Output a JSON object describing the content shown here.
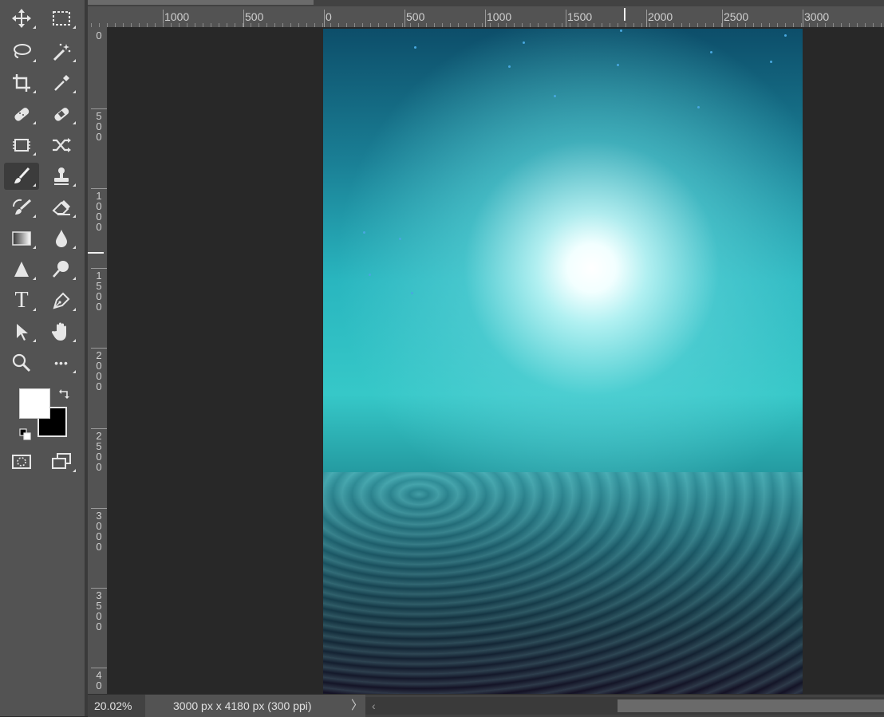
{
  "toolbar": {
    "tools": [
      {
        "name": "move-tool",
        "icon": "move-icon"
      },
      {
        "name": "marquee-tool",
        "icon": "rectangular-marquee-icon"
      },
      {
        "name": "lasso-tool",
        "icon": "lasso-icon"
      },
      {
        "name": "magic-wand-tool",
        "icon": "magic-wand-icon"
      },
      {
        "name": "crop-tool",
        "icon": "crop-icon"
      },
      {
        "name": "eyedropper-tool",
        "icon": "eyedropper-icon"
      },
      {
        "name": "spot-healing-tool",
        "icon": "spot-healing-bandage-icon"
      },
      {
        "name": "healing-brush-tool",
        "icon": "bandage-icon"
      },
      {
        "name": "content-aware-tool",
        "icon": "content-aware-icon"
      },
      {
        "name": "content-aware-move-tool",
        "icon": "shuffle-icon"
      },
      {
        "name": "brush-tool",
        "icon": "brush-icon",
        "active": true
      },
      {
        "name": "clone-stamp-tool",
        "icon": "stamp-icon"
      },
      {
        "name": "history-brush-tool",
        "icon": "history-brush-icon"
      },
      {
        "name": "eraser-tool",
        "icon": "eraser-icon"
      },
      {
        "name": "gradient-tool",
        "icon": "gradient-icon"
      },
      {
        "name": "blur-tool",
        "icon": "drop-icon"
      },
      {
        "name": "sharpen-tool",
        "icon": "triangle-icon"
      },
      {
        "name": "dodge-tool",
        "icon": "dodge-icon"
      },
      {
        "name": "type-tool",
        "icon": "type-icon",
        "glyph": "T"
      },
      {
        "name": "pen-tool",
        "icon": "pen-icon"
      },
      {
        "name": "path-selection-tool",
        "icon": "arrow-cursor-icon"
      },
      {
        "name": "hand-tool",
        "icon": "hand-icon"
      },
      {
        "name": "zoom-tool",
        "icon": "magnifier-icon"
      },
      {
        "name": "more-tools",
        "icon": "ellipsis-icon",
        "glyph": "•••"
      }
    ],
    "foreground_color": "#ffffff",
    "background_color": "#000000"
  },
  "ruler_h": {
    "labels": [
      "1000",
      "500",
      "0",
      "500",
      "1000",
      "1500",
      "2000",
      "2500",
      "3000"
    ]
  },
  "ruler_v": {
    "labels": [
      "0",
      "500",
      "1000",
      "1500",
      "2000",
      "2500",
      "3000",
      "3500",
      "40"
    ]
  },
  "statusbar": {
    "zoom": "20.02%",
    "doc_info": "3000 px x 4180 px (300 ppi)",
    "arrow": "〉",
    "scroll_left": "‹"
  }
}
